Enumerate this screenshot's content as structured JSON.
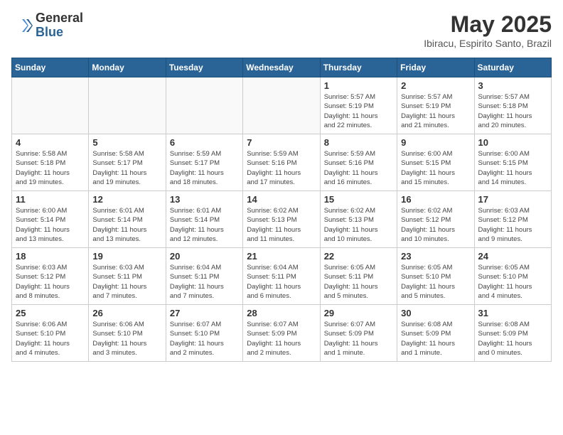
{
  "header": {
    "logo_general": "General",
    "logo_blue": "Blue",
    "title": "May 2025",
    "subtitle": "Ibiracu, Espirito Santo, Brazil"
  },
  "weekdays": [
    "Sunday",
    "Monday",
    "Tuesday",
    "Wednesday",
    "Thursday",
    "Friday",
    "Saturday"
  ],
  "weeks": [
    [
      {
        "num": "",
        "info": "",
        "empty": true
      },
      {
        "num": "",
        "info": "",
        "empty": true
      },
      {
        "num": "",
        "info": "",
        "empty": true
      },
      {
        "num": "",
        "info": "",
        "empty": true
      },
      {
        "num": "1",
        "info": "Sunrise: 5:57 AM\nSunset: 5:19 PM\nDaylight: 11 hours\nand 22 minutes."
      },
      {
        "num": "2",
        "info": "Sunrise: 5:57 AM\nSunset: 5:19 PM\nDaylight: 11 hours\nand 21 minutes."
      },
      {
        "num": "3",
        "info": "Sunrise: 5:57 AM\nSunset: 5:18 PM\nDaylight: 11 hours\nand 20 minutes."
      }
    ],
    [
      {
        "num": "4",
        "info": "Sunrise: 5:58 AM\nSunset: 5:18 PM\nDaylight: 11 hours\nand 19 minutes."
      },
      {
        "num": "5",
        "info": "Sunrise: 5:58 AM\nSunset: 5:17 PM\nDaylight: 11 hours\nand 19 minutes."
      },
      {
        "num": "6",
        "info": "Sunrise: 5:59 AM\nSunset: 5:17 PM\nDaylight: 11 hours\nand 18 minutes."
      },
      {
        "num": "7",
        "info": "Sunrise: 5:59 AM\nSunset: 5:16 PM\nDaylight: 11 hours\nand 17 minutes."
      },
      {
        "num": "8",
        "info": "Sunrise: 5:59 AM\nSunset: 5:16 PM\nDaylight: 11 hours\nand 16 minutes."
      },
      {
        "num": "9",
        "info": "Sunrise: 6:00 AM\nSunset: 5:15 PM\nDaylight: 11 hours\nand 15 minutes."
      },
      {
        "num": "10",
        "info": "Sunrise: 6:00 AM\nSunset: 5:15 PM\nDaylight: 11 hours\nand 14 minutes."
      }
    ],
    [
      {
        "num": "11",
        "info": "Sunrise: 6:00 AM\nSunset: 5:14 PM\nDaylight: 11 hours\nand 13 minutes."
      },
      {
        "num": "12",
        "info": "Sunrise: 6:01 AM\nSunset: 5:14 PM\nDaylight: 11 hours\nand 13 minutes."
      },
      {
        "num": "13",
        "info": "Sunrise: 6:01 AM\nSunset: 5:14 PM\nDaylight: 11 hours\nand 12 minutes."
      },
      {
        "num": "14",
        "info": "Sunrise: 6:02 AM\nSunset: 5:13 PM\nDaylight: 11 hours\nand 11 minutes."
      },
      {
        "num": "15",
        "info": "Sunrise: 6:02 AM\nSunset: 5:13 PM\nDaylight: 11 hours\nand 10 minutes."
      },
      {
        "num": "16",
        "info": "Sunrise: 6:02 AM\nSunset: 5:12 PM\nDaylight: 11 hours\nand 10 minutes."
      },
      {
        "num": "17",
        "info": "Sunrise: 6:03 AM\nSunset: 5:12 PM\nDaylight: 11 hours\nand 9 minutes."
      }
    ],
    [
      {
        "num": "18",
        "info": "Sunrise: 6:03 AM\nSunset: 5:12 PM\nDaylight: 11 hours\nand 8 minutes."
      },
      {
        "num": "19",
        "info": "Sunrise: 6:03 AM\nSunset: 5:11 PM\nDaylight: 11 hours\nand 7 minutes."
      },
      {
        "num": "20",
        "info": "Sunrise: 6:04 AM\nSunset: 5:11 PM\nDaylight: 11 hours\nand 7 minutes."
      },
      {
        "num": "21",
        "info": "Sunrise: 6:04 AM\nSunset: 5:11 PM\nDaylight: 11 hours\nand 6 minutes."
      },
      {
        "num": "22",
        "info": "Sunrise: 6:05 AM\nSunset: 5:11 PM\nDaylight: 11 hours\nand 5 minutes."
      },
      {
        "num": "23",
        "info": "Sunrise: 6:05 AM\nSunset: 5:10 PM\nDaylight: 11 hours\nand 5 minutes."
      },
      {
        "num": "24",
        "info": "Sunrise: 6:05 AM\nSunset: 5:10 PM\nDaylight: 11 hours\nand 4 minutes."
      }
    ],
    [
      {
        "num": "25",
        "info": "Sunrise: 6:06 AM\nSunset: 5:10 PM\nDaylight: 11 hours\nand 4 minutes."
      },
      {
        "num": "26",
        "info": "Sunrise: 6:06 AM\nSunset: 5:10 PM\nDaylight: 11 hours\nand 3 minutes."
      },
      {
        "num": "27",
        "info": "Sunrise: 6:07 AM\nSunset: 5:10 PM\nDaylight: 11 hours\nand 2 minutes."
      },
      {
        "num": "28",
        "info": "Sunrise: 6:07 AM\nSunset: 5:09 PM\nDaylight: 11 hours\nand 2 minutes."
      },
      {
        "num": "29",
        "info": "Sunrise: 6:07 AM\nSunset: 5:09 PM\nDaylight: 11 hours\nand 1 minute."
      },
      {
        "num": "30",
        "info": "Sunrise: 6:08 AM\nSunset: 5:09 PM\nDaylight: 11 hours\nand 1 minute."
      },
      {
        "num": "31",
        "info": "Sunrise: 6:08 AM\nSunset: 5:09 PM\nDaylight: 11 hours\nand 0 minutes."
      }
    ]
  ]
}
